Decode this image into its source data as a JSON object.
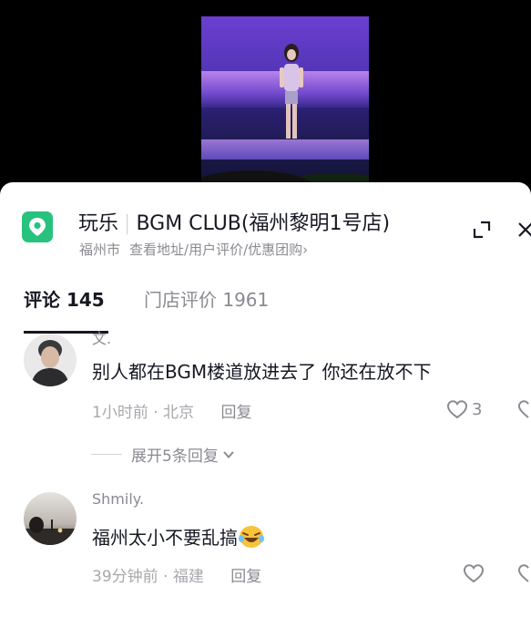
{
  "poi": {
    "category": "玩乐",
    "name": "BGM CLUB(福州黎明1号店)",
    "city": "福州市",
    "links": "查看地址/用户评价/优惠团购",
    "chevron": "›",
    "icon": "map-pin-icon",
    "icon_color": "#27c27e"
  },
  "tabs": {
    "comments_label": "评论 145",
    "reviews_label": "门店评价 1961"
  },
  "comments": [
    {
      "username": "文.",
      "text": "别人都在BGM楼道放进去了 你还在放不下",
      "time": "1小时前",
      "dot": "·",
      "location": "北京",
      "reply_label": "回复",
      "likes": "3",
      "expand_label": "展开5条回复"
    },
    {
      "username": "Shmily.",
      "text": "福州太小不要乱搞",
      "time": "39分钟前",
      "dot": "·",
      "location": "福建",
      "reply_label": "回复",
      "likes": ""
    }
  ],
  "colors": {
    "primary_text": "#161823",
    "secondary_text": "#8a8b91",
    "accent_green": "#27c27e"
  }
}
